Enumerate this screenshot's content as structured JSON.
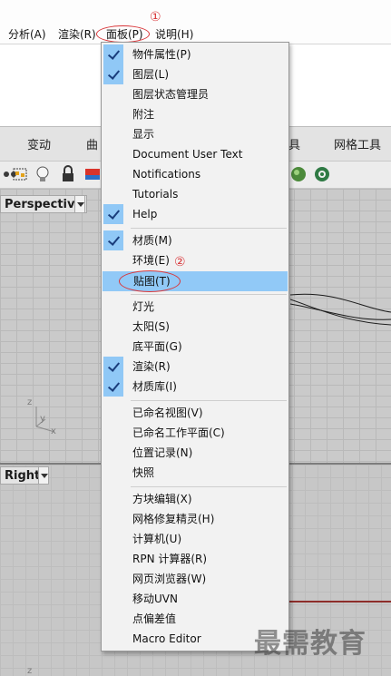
{
  "menubar": {
    "items": [
      "分析(A)",
      "渲染(R)",
      "面板(P)",
      "说明(H)"
    ]
  },
  "tabs": [
    "变动",
    "曲",
    "具",
    "网格工具"
  ],
  "viewports": {
    "perspective": "Perspective",
    "right": "Right",
    "axis_z": "z",
    "axis_y": "y",
    "axis_x": "x"
  },
  "annotations": {
    "one": "①",
    "two": "②"
  },
  "menu": {
    "items": [
      {
        "label": "物件属性(P)",
        "checked": true
      },
      {
        "label": "图层(L)",
        "checked": true
      },
      {
        "label": "图层状态管理员",
        "checked": false
      },
      {
        "label": "附注",
        "checked": false
      },
      {
        "label": "显示",
        "checked": false
      },
      {
        "label": "Document User Text",
        "checked": false
      },
      {
        "label": "Notifications",
        "checked": false
      },
      {
        "label": "Tutorials",
        "checked": false
      },
      {
        "label": "Help",
        "checked": true
      },
      {
        "label": "材质(M)",
        "checked": true
      },
      {
        "label": "环境(E)",
        "checked": false
      },
      {
        "label": "贴图(T)",
        "checked": false,
        "highlighted": true
      },
      {
        "label": "灯光",
        "checked": false
      },
      {
        "label": "太阳(S)",
        "checked": false
      },
      {
        "label": "底平面(G)",
        "checked": false
      },
      {
        "label": "渲染(R)",
        "checked": true
      },
      {
        "label": "材质库(I)",
        "checked": true
      },
      {
        "label": "已命名视图(V)",
        "checked": false
      },
      {
        "label": "已命名工作平面(C)",
        "checked": false
      },
      {
        "label": "位置记录(N)",
        "checked": false
      },
      {
        "label": "快照",
        "checked": false
      },
      {
        "label": "方块编辑(X)",
        "checked": false
      },
      {
        "label": "网格修复精灵(H)",
        "checked": false
      },
      {
        "label": "计算机(U)",
        "checked": false
      },
      {
        "label": "RPN 计算器(R)",
        "checked": false
      },
      {
        "label": "网页浏览器(W)",
        "checked": false
      },
      {
        "label": "移动UVN",
        "checked": false
      },
      {
        "label": "点偏差值",
        "checked": false
      },
      {
        "label": "Macro Editor",
        "checked": false
      }
    ]
  },
  "watermark": "最需教育",
  "colors": {
    "highlight": "#91c9f7",
    "check_bg": "#90c8f6",
    "annotation": "#d9373a"
  }
}
